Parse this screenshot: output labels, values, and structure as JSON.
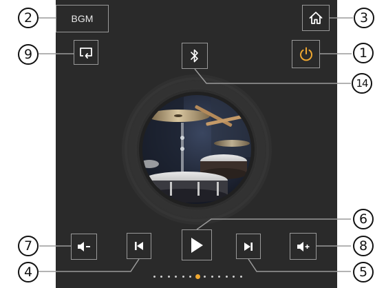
{
  "buttons": {
    "bgm_label": "BGM"
  },
  "callouts": {
    "c1": "1",
    "c2": "2",
    "c3": "3",
    "c4": "4",
    "c5": "5",
    "c6": "6",
    "c7": "7",
    "c8": "8",
    "c9": "9",
    "c14": "14"
  },
  "carousel": {
    "dot_count": 13,
    "active_index": 6
  },
  "colors": {
    "panel_background": "#2a2a2a",
    "button_border": "#9a9a9a",
    "icon": "#ffffff",
    "power_accent": "#f0a830",
    "active_dot": "#f0a830"
  },
  "icons": {
    "bgm": "text-button",
    "home": "home-icon",
    "loop": "loop-icon",
    "bluetooth": "bluetooth-icon",
    "power": "power-icon",
    "volume_down": "volume-down-icon",
    "previous": "previous-track-icon",
    "play": "play-icon",
    "next": "next-track-icon",
    "volume_up": "volume-up-icon"
  }
}
